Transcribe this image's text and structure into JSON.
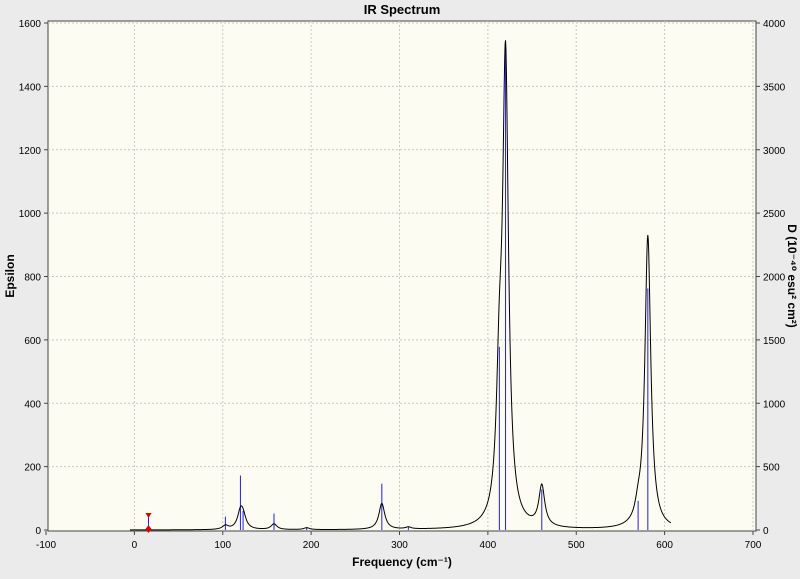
{
  "chart_data": {
    "type": "line",
    "title": "IR Spectrum",
    "xlabel": "Frequency (cm⁻¹)",
    "ylabel": "Epsilon",
    "ylabel_right": "D (10⁻⁴⁰ esu² cm²)",
    "xlim": [
      -100,
      700
    ],
    "ylim": [
      0,
      1600
    ],
    "ylim_right": [
      0,
      4000
    ],
    "xticks": [
      -100,
      0,
      100,
      200,
      300,
      400,
      500,
      600,
      700
    ],
    "yticks": [
      0,
      200,
      400,
      600,
      800,
      1000,
      1200,
      1400,
      1600
    ],
    "yticks_right": [
      0,
      500,
      1000,
      1500,
      2000,
      2500,
      3000,
      3500,
      4000
    ],
    "grid": true,
    "spectrum_peaks": [
      {
        "freq": 103,
        "eps": 12,
        "hw": 4
      },
      {
        "freq": 120,
        "eps": 50,
        "hw": 4
      },
      {
        "freq": 123,
        "eps": 35,
        "hw": 4
      },
      {
        "freq": 158,
        "eps": 18,
        "hw": 4
      },
      {
        "freq": 195,
        "eps": 6,
        "hw": 4
      },
      {
        "freq": 280,
        "eps": 82,
        "hw": 4
      },
      {
        "freq": 310,
        "eps": 6,
        "hw": 4
      },
      {
        "freq": 413,
        "eps": 380,
        "hw": 4
      },
      {
        "freq": 420,
        "eps": 1450,
        "hw": 4
      },
      {
        "freq": 461,
        "eps": 128,
        "hw": 4
      },
      {
        "freq": 570,
        "eps": 40,
        "hw": 4
      },
      {
        "freq": 581,
        "eps": 925,
        "hw": 4
      }
    ],
    "stick_series": {
      "name": "D",
      "sticks": [
        {
          "freq": 16,
          "d": 110
        },
        {
          "freq": 103,
          "d": 105
        },
        {
          "freq": 120,
          "d": 430
        },
        {
          "freq": 123,
          "d": 150
        },
        {
          "freq": 158,
          "d": 130
        },
        {
          "freq": 195,
          "d": 18
        },
        {
          "freq": 280,
          "d": 365
        },
        {
          "freq": 310,
          "d": 25
        },
        {
          "freq": 413,
          "d": 1445
        },
        {
          "freq": 420,
          "d": 3840
        },
        {
          "freq": 461,
          "d": 320
        },
        {
          "freq": 570,
          "d": 230
        },
        {
          "freq": 581,
          "d": 1905
        }
      ]
    },
    "marker": {
      "freq": 16,
      "d": 110
    },
    "colors": {
      "curve": "#000000",
      "sticks": "#2020e0",
      "marker": "#e00000",
      "plot_bg": "#fcfcf2",
      "grid": "#c8c8c8"
    }
  }
}
